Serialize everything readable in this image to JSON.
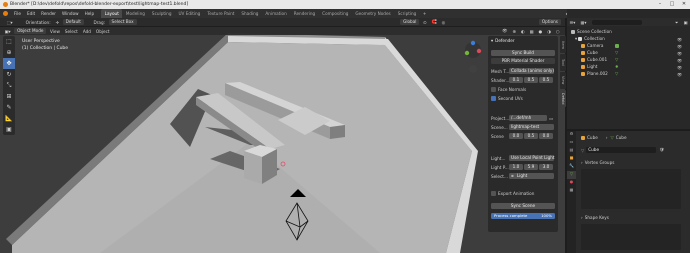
{
  "window": {
    "title": "Blender* [D:\\dev\\defold\\repos\\defold-blender-export\\test\\lightmap-test1.blend]"
  },
  "menus": [
    "File",
    "Edit",
    "Render",
    "Window",
    "Help"
  ],
  "workspaces": [
    "Layout",
    "Modeling",
    "Sculpting",
    "UV Editing",
    "Texture Paint",
    "Shading",
    "Animation",
    "Rendering",
    "Compositing",
    "Geometry Nodes",
    "Scripting"
  ],
  "active_workspace": "Layout",
  "scene": {
    "name": "Scene",
    "view_layer": "View Layer"
  },
  "tool_header": {
    "orientation_label": "Orientation:",
    "orientation_value": "Default",
    "drag_label": "Drag:",
    "drag_value": "Select Box",
    "transform": "Global",
    "options": "Options"
  },
  "viewport_header": {
    "mode": "Object Mode",
    "menus": [
      "View",
      "Select",
      "Add",
      "Object"
    ]
  },
  "viewport_info": {
    "line1": "User Perspective",
    "line2": "(1) Collection | Cube"
  },
  "npanel": {
    "title": "Defender",
    "sync_build": "Sync Build",
    "pbr_shader": "PBR Material Shader",
    "mesh_t_label": "Mesh T...",
    "mesh_t_value": "Collada (anims only)",
    "shader_label": "Shader...",
    "shader_values": [
      "0.1",
      "0.5",
      "0.5"
    ],
    "face_normals": "Face Normals",
    "second_uvs": "Second UVs",
    "project_label": "Project...",
    "project_value": "/...def/mh",
    "scene_label": "Scene...",
    "scene_value": "lightmap-test",
    "scene_values_label": "Scene",
    "scene_values": [
      "0.0",
      "0.5",
      "0.0"
    ],
    "light_label": "Light...",
    "light_value": "Use Local Point Light",
    "light_p_label": "Light P...",
    "light_p_values": [
      "1.0",
      "5.9",
      "3.0"
    ],
    "select_label": "Select...",
    "select_value": "Light",
    "export_animation": "Export Animation",
    "sync_scene": "Sync Scene",
    "process_label": "Process complete",
    "process_pct": "100%",
    "progress": 1.0
  },
  "npanel_tabs": [
    "Item",
    "Tool",
    "View",
    "Defold"
  ],
  "outliner": {
    "root": "Scene Collection",
    "collection": "Collection",
    "items": [
      "Camera",
      "Cube",
      "Cube.001",
      "Light",
      "Plane.002"
    ]
  },
  "properties": {
    "breadcrumb_a": "Cube",
    "breadcrumb_b": "Cube",
    "mesh_name": "Cube",
    "vertex_groups": "Vertex Groups",
    "shape_keys": "Shape Keys"
  },
  "colors": {
    "accent": "#4772b3",
    "orange": "#e8a33a",
    "green": "#6ab04c"
  }
}
